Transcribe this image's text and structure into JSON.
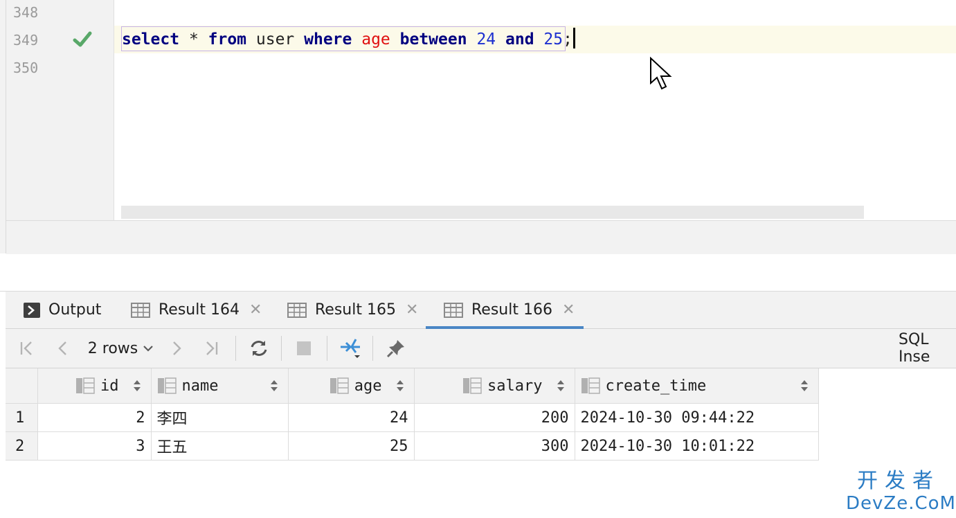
{
  "editor": {
    "line_numbers": [
      "348",
      "349",
      "350"
    ],
    "code_tokens": [
      {
        "text": "select",
        "cls": "kw"
      },
      {
        "text": " * ",
        "cls": "id"
      },
      {
        "text": "from",
        "cls": "kw"
      },
      {
        "text": " user ",
        "cls": "id"
      },
      {
        "text": "where",
        "cls": "kw"
      },
      {
        "text": " ",
        "cls": "id"
      },
      {
        "text": "age",
        "cls": "col"
      },
      {
        "text": " ",
        "cls": "id"
      },
      {
        "text": "between",
        "cls": "kw"
      },
      {
        "text": " ",
        "cls": "id"
      },
      {
        "text": "24",
        "cls": "num"
      },
      {
        "text": " ",
        "cls": "id"
      },
      {
        "text": "and",
        "cls": "kw"
      },
      {
        "text": " ",
        "cls": "id"
      },
      {
        "text": "25",
        "cls": "num"
      },
      {
        "text": ";",
        "cls": "id"
      }
    ],
    "status_icon": "checkmark-icon",
    "colors": {
      "keyword": "#000080",
      "column": "#e01010",
      "number": "#1d30d0",
      "check": "#59a869"
    }
  },
  "tabs": [
    {
      "label": "Output",
      "icon": "console-icon",
      "closable": false,
      "active": false
    },
    {
      "label": "Result 164",
      "icon": "table-icon",
      "closable": true,
      "active": false
    },
    {
      "label": "Result 165",
      "icon": "table-icon",
      "closable": true,
      "active": false
    },
    {
      "label": "Result 166",
      "icon": "table-icon",
      "closable": true,
      "active": true
    }
  ],
  "toolbar": {
    "rows_label": "2 rows",
    "right_label": "SQL Inse",
    "icons": [
      "first-page-icon",
      "prev-page-icon",
      "next-page-icon",
      "last-page-icon",
      "refresh-icon",
      "stop-icon",
      "compare-icon",
      "pin-icon"
    ]
  },
  "grid": {
    "columns": [
      "id",
      "name",
      "age",
      "salary",
      "create_time"
    ],
    "rows": [
      {
        "num": "1",
        "id": "2",
        "name": "李四",
        "age": "24",
        "salary": "200",
        "create_time": "2024-10-30 09:44:22"
      },
      {
        "num": "2",
        "id": "3",
        "name": "王五",
        "age": "25",
        "salary": "300",
        "create_time": "2024-10-30 10:01:22"
      }
    ]
  },
  "watermark": {
    "top": "开发者",
    "bottom": "DevZe.CoM"
  },
  "accent": "#4a86c5"
}
